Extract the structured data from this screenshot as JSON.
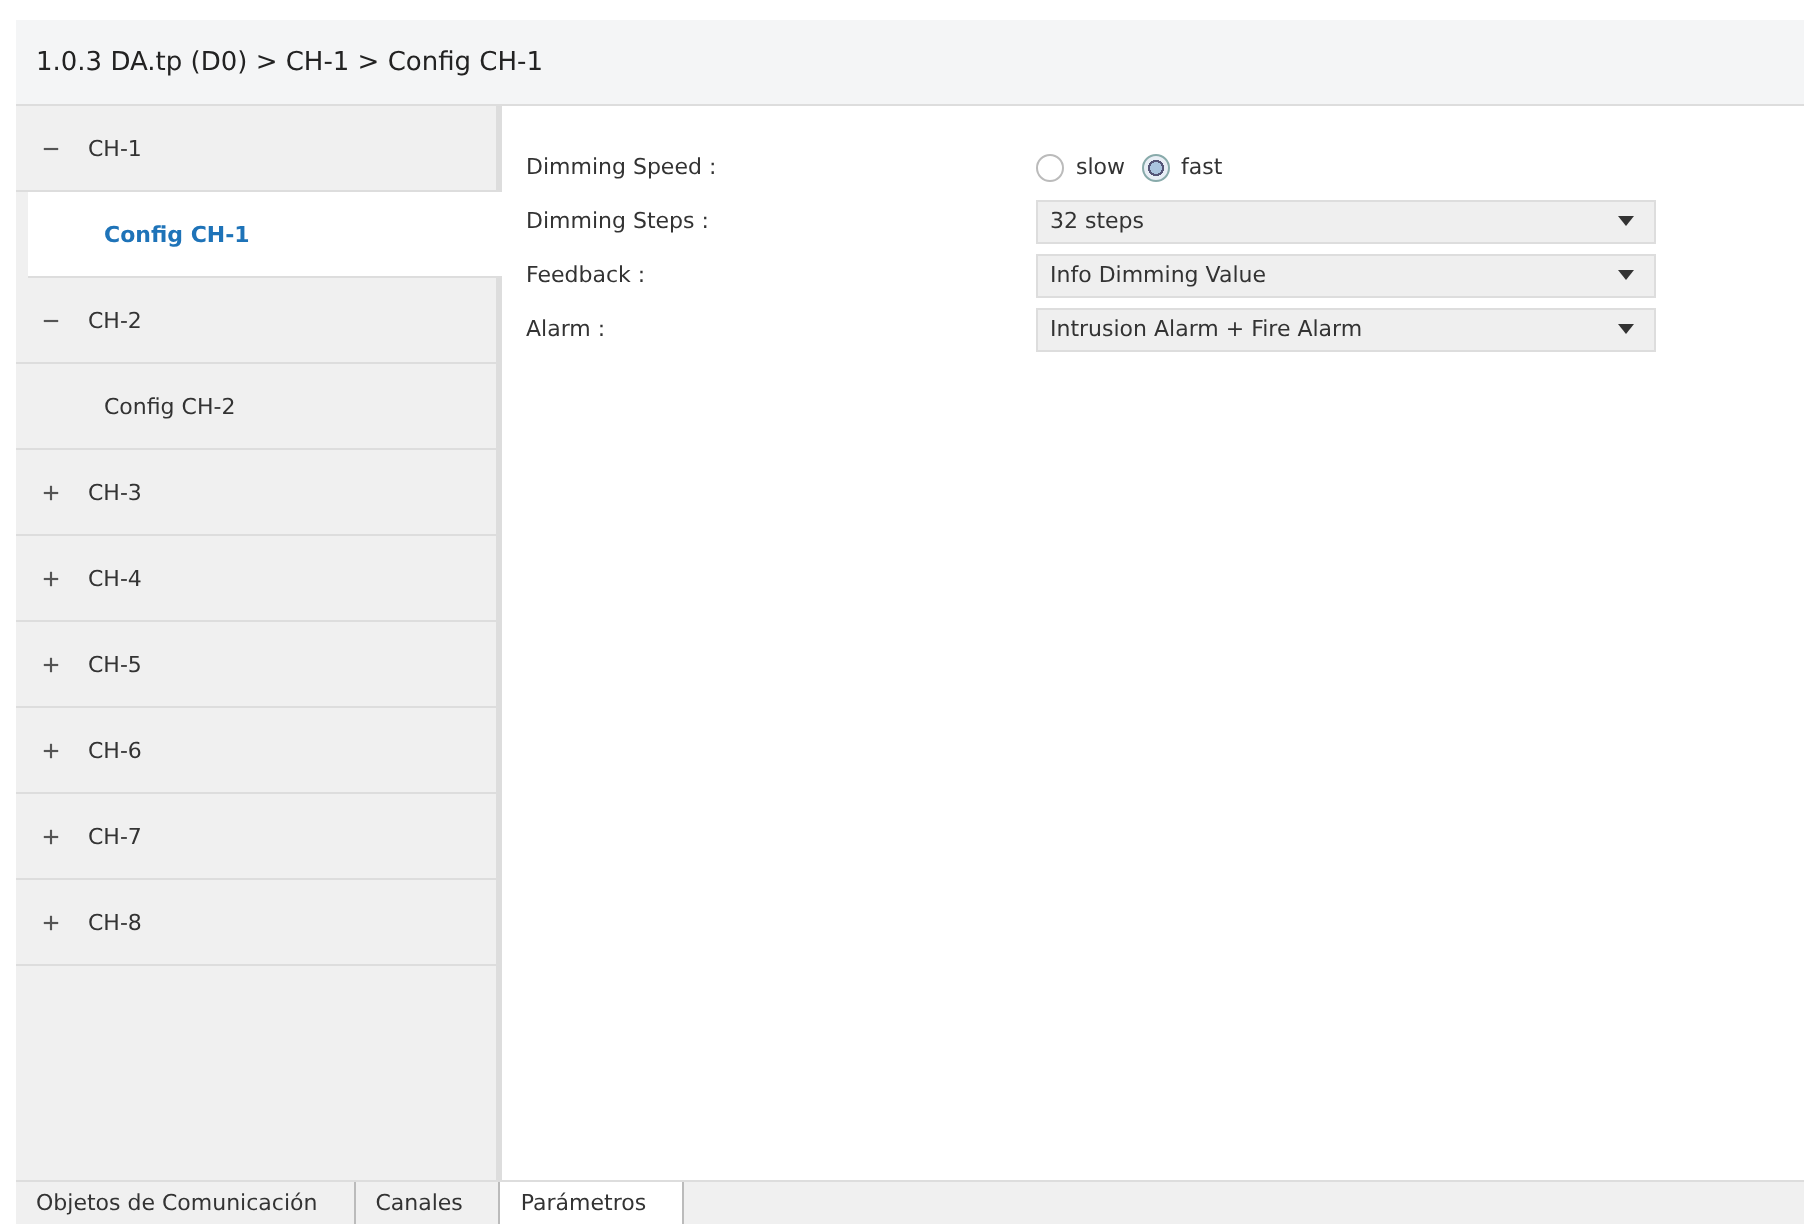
{
  "breadcrumb": "1.0.3 DA.tp (D0) > CH-1 > Config CH-1",
  "tree": [
    {
      "label": "CH-1",
      "expanded": true,
      "children": [
        {
          "label": "Config CH-1",
          "selected": true
        }
      ]
    },
    {
      "label": "CH-2",
      "expanded": true,
      "children": [
        {
          "label": "Config CH-2",
          "selected": false
        }
      ]
    },
    {
      "label": "CH-3",
      "expanded": false
    },
    {
      "label": "CH-4",
      "expanded": false
    },
    {
      "label": "CH-5",
      "expanded": false
    },
    {
      "label": "CH-6",
      "expanded": false
    },
    {
      "label": "CH-7",
      "expanded": false
    },
    {
      "label": "CH-8",
      "expanded": false
    }
  ],
  "parameters": [
    {
      "kind": "radio",
      "label": "Dimming Speed :",
      "options": [
        {
          "label": "slow",
          "selected": false
        },
        {
          "label": "fast",
          "selected": true
        }
      ]
    },
    {
      "kind": "select",
      "label": "Dimming Steps :",
      "value": "32 steps"
    },
    {
      "kind": "select",
      "label": "Feedback :",
      "value": "Info Dimming Value"
    },
    {
      "kind": "select",
      "label": "Alarm :",
      "value": "Intrusion Alarm + Fire Alarm"
    }
  ],
  "tabs": [
    {
      "label": "Objetos de Comunicación",
      "selected": false
    },
    {
      "label": "Canales",
      "selected": false
    },
    {
      "label": "Parámetros",
      "selected": true
    }
  ]
}
